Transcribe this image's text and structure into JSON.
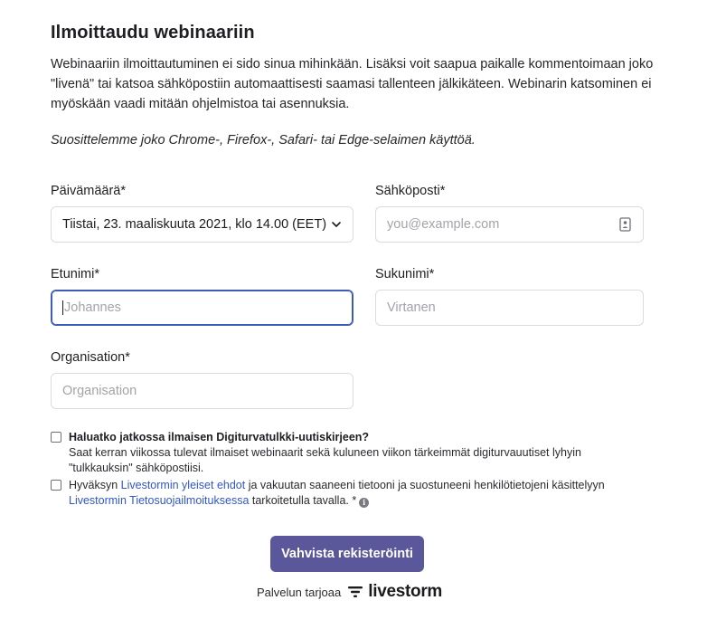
{
  "form": {
    "title": "Ilmoittaudu webinaariin",
    "intro": "Webinaariin ilmoittautuminen ei sido sinua mihinkään. Lisäksi voit saapua paikalle kommentoimaan joko \"livenä\" tai katsoa sähköpostiin automaattisesti saamasi tallenteen jälkikäteen. Webinarin katsominen ei myöskään vaadi mitään ohjelmistoa tai asennuksia.",
    "browser_note": "Suosittelemme joko Chrome-, Firefox-, Safari- tai Edge-selaimen käyttöä.",
    "date": {
      "label": "Päivämäärä*",
      "value": "Tiistai, 23. maaliskuuta 2021, klo 14.00 (EET)"
    },
    "email": {
      "label": "Sähköposti*",
      "placeholder": "you@example.com",
      "value": ""
    },
    "first_name": {
      "label": "Etunimi*",
      "placeholder": "Johannes",
      "value": ""
    },
    "last_name": {
      "label": "Sukunimi*",
      "placeholder": "Virtanen",
      "value": ""
    },
    "organisation": {
      "label": "Organisation*",
      "placeholder": "Organisation",
      "value": ""
    },
    "newsletter": {
      "question": "Haluatko jatkossa ilmaisen Digiturvatulkki-uutiskirjeen?",
      "description": "Saat kerran viikossa tulevat ilmaiset webinaarit sekä kuluneen viikon tärkeimmät digiturvauutiset lyhyin \"tulkkauksin\" sähköpostiisi.",
      "checked": false
    },
    "consent": {
      "text_1": "Hyväksyn ",
      "link_1": "Livestormin yleiset ehdot",
      "text_2": " ja vakuutan saaneeni tietooni ja suostuneeni henkilötietojeni käsittelyyn ",
      "link_2": "Livestormin Tietosuojailmoituksessa",
      "text_3": " tarkoitetulla tavalla. *",
      "checked": false
    },
    "submit_label": "Vahvista rekisteröinti"
  },
  "footer": {
    "powered_by": "Palvelun tarjoaa",
    "brand": "livestorm"
  },
  "icons": {
    "date_dropdown": "chevron-down-icon",
    "email_field": "contact-card-icon",
    "consent_info": "info-icon",
    "brand": "livestorm-logo-icon"
  },
  "colors": {
    "primary_button": "#5a589a",
    "link": "#3256c9",
    "focus_border": "#3f5bb8"
  }
}
